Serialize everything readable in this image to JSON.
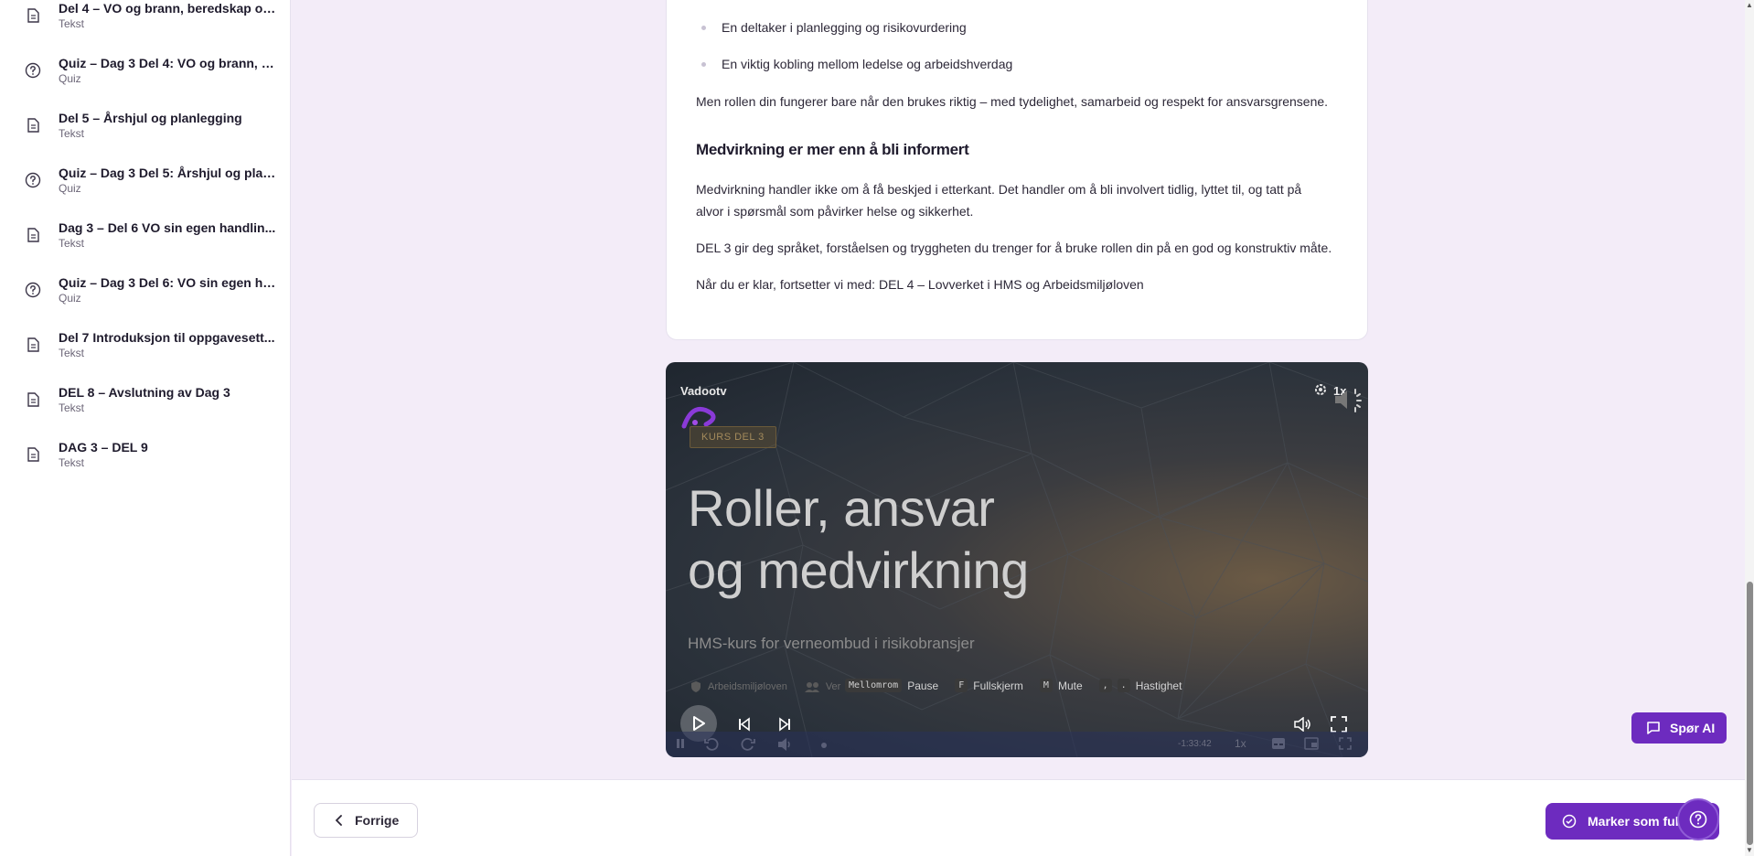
{
  "sidebar": {
    "items": [
      {
        "title": "Del 4 – VO og brann, beredskap og...",
        "type": "Tekst",
        "icon": "document-icon"
      },
      {
        "title": "Quiz – Dag 3 Del 4: VO og brann, b...",
        "type": "Quiz",
        "icon": "question-circle-icon"
      },
      {
        "title": "Del 5 – Årshjul og planlegging",
        "type": "Tekst",
        "icon": "document-icon"
      },
      {
        "title": "Quiz – Dag 3 Del 5: Årshjul og plan...",
        "type": "Quiz",
        "icon": "question-circle-icon"
      },
      {
        "title": "Dag 3 – Del 6 VO sin egen handlin...",
        "type": "Tekst",
        "icon": "document-icon"
      },
      {
        "title": "Quiz – Dag 3 Del 6: VO sin egen ha...",
        "type": "Quiz",
        "icon": "question-circle-icon"
      },
      {
        "title": "Del 7 Introduksjon til oppgavesett...",
        "type": "Tekst",
        "icon": "document-icon"
      },
      {
        "title": "DEL 8 – Avslutning av Dag 3",
        "type": "Tekst",
        "icon": "document-icon"
      },
      {
        "title": "DAG 3 – DEL 9",
        "type": "Tekst",
        "icon": "document-icon"
      }
    ]
  },
  "content": {
    "bullets": [
      "En deltaker i planlegging og risikovurdering",
      "En viktig kobling mellom ledelse og arbeidshverdag"
    ],
    "para1": "Men rollen din fungerer bare når den brukes riktig – med tydelighet, samarbeid og respekt for ansvarsgrensene.",
    "heading": "Medvirkning er mer enn å bli informert",
    "para2_line1": "Medvirkning handler ikke om å få beskjed i etterkant. Det handler om å bli involvert tidlig, lyttet til, og tatt på",
    "para2_line2": "alvor i spørsmål som påvirker helse og sikkerhet.",
    "para3": "DEL 3 gir deg språket, forståelsen og tryggheten du trenger for å bruke rollen din på en god og konstruktiv måte.",
    "para4": "Når du er klar, fortsetter vi med: DEL 4 – Lovverket i HMS og Arbeidsmiljøloven"
  },
  "video": {
    "brand": "Vadootv",
    "badge": "KURS DEL 3",
    "title_line1": "Roller, ansvar",
    "title_line2": "og medvirkning",
    "subtitle": "HMS-kurs for verneombud i risikobransjer",
    "meta1": "Arbeidsmiljøloven",
    "meta2": "Ver",
    "speed": "1x",
    "shortcuts": [
      {
        "key": "Mellomrom",
        "label": "Pause"
      },
      {
        "key": "F",
        "label": "Fullskjerm"
      },
      {
        "key": "M",
        "label": "Mute"
      },
      {
        "key": ",",
        "key2": ".",
        "label": "Hastighet"
      }
    ],
    "time_remaining": "-1:33:42",
    "bar_speed": "1x"
  },
  "footer": {
    "prev_label": "Forrige",
    "complete_label": "Marker som fullført",
    "ask_ai_label": "Spør AI"
  },
  "colors": {
    "accent": "#6d2bbf",
    "background": "#f3ecf8"
  }
}
